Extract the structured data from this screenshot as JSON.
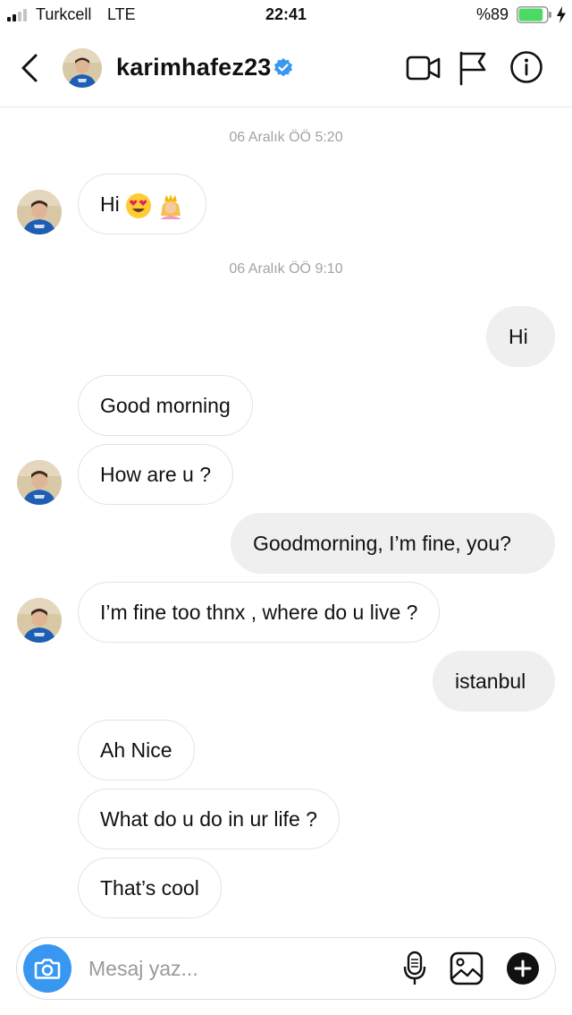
{
  "status_bar": {
    "carrier": "Turkcell",
    "network": "LTE",
    "time": "22:41",
    "battery": "%89",
    "battery_level": 0.89
  },
  "header": {
    "username": "karimhafez23",
    "verified": true,
    "icons": [
      "back-icon",
      "video-camera-icon",
      "flag-icon",
      "info-icon"
    ]
  },
  "timestamps": [
    "06 Aralık ÖÖ 5:20",
    "06 Aralık ÖÖ 9:10"
  ],
  "messages": [
    {
      "from": "them",
      "text": "Hi",
      "emojis": [
        "heart-eyes-emoji",
        "princess-emoji"
      ]
    },
    {
      "from": "me",
      "text": "Hi"
    },
    {
      "from": "them",
      "text": "Good morning"
    },
    {
      "from": "them",
      "text": "How are u ?"
    },
    {
      "from": "me",
      "text": "Goodmorning, I’m fine, you?"
    },
    {
      "from": "them",
      "text": "I’m fine too thnx , where do u live ?"
    },
    {
      "from": "me",
      "text": "istanbul"
    },
    {
      "from": "them",
      "text": "Ah Nice"
    },
    {
      "from": "them",
      "text": "What do u do in ur life ?"
    },
    {
      "from": "them",
      "text": "That’s cool"
    }
  ],
  "composer": {
    "placeholder": "Mesaj yaz...",
    "value": "",
    "icons": [
      "camera-icon",
      "microphone-icon",
      "gallery-icon",
      "plus-icon"
    ]
  },
  "colors": {
    "accent": "#3897f0",
    "incoming_bubble_border": "#e3e3e3",
    "outgoing_bubble": "#efefef",
    "timestamp": "#a3a3a3",
    "battery": "#4cd964"
  }
}
